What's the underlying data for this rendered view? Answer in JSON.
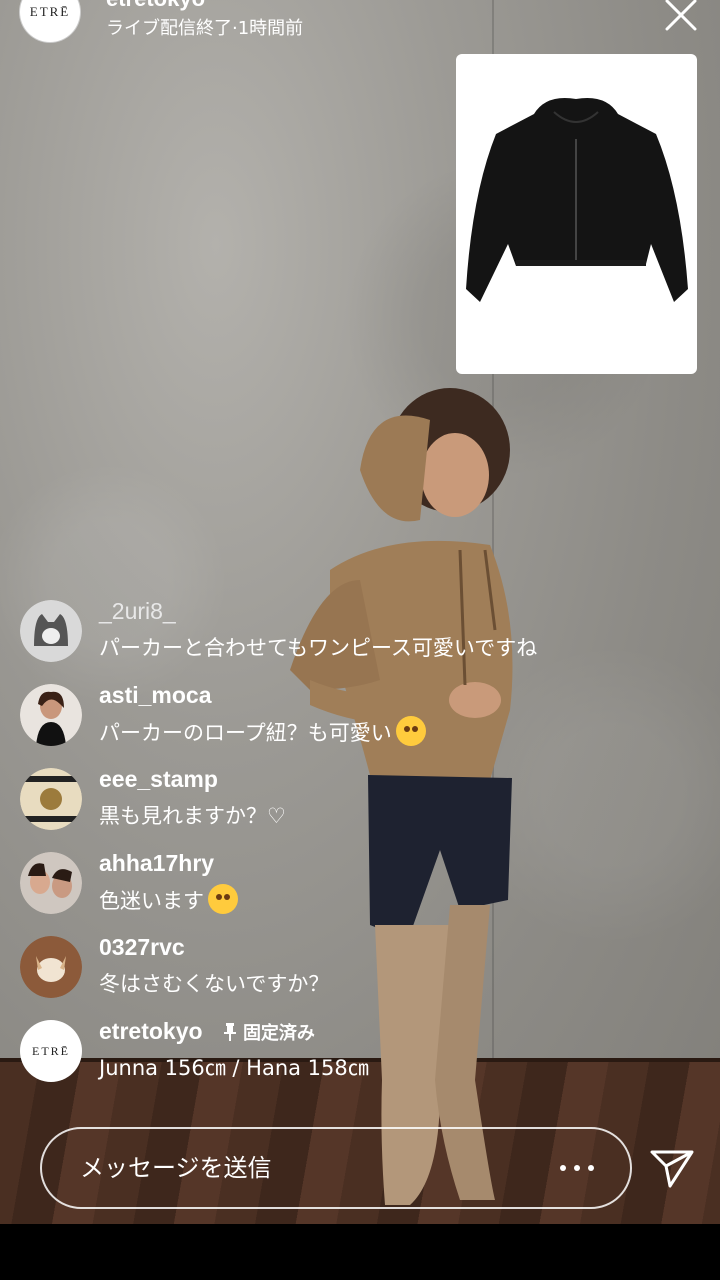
{
  "header": {
    "brand_logo_text": "ETRĒ",
    "username": "etretokyo",
    "status": "ライブ配信終了·1時間前"
  },
  "icons": {
    "close": "close-icon",
    "more": "more-icon",
    "send": "send-icon",
    "pin": "pin-icon"
  },
  "comments": [
    {
      "user": "_2uri8_",
      "text": "パーカーと合わせてもワンピース可愛いですね"
    },
    {
      "user": "asti_moca",
      "text": "パーカーのロープ紐？も可愛い"
    },
    {
      "user": "eee_stamp",
      "text": "黒も見れますか？♡"
    },
    {
      "user": "ahha17hry",
      "text": "色迷います"
    },
    {
      "user": "0327rvc",
      "text": "冬はさむくないですか？"
    }
  ],
  "pinned_comment": {
    "user": "etretokyo",
    "pinned_label": "固定済み",
    "text": "Junna 156㎝ / Hana 158㎝"
  },
  "message_bar": {
    "placeholder": "メッセージを送信"
  }
}
